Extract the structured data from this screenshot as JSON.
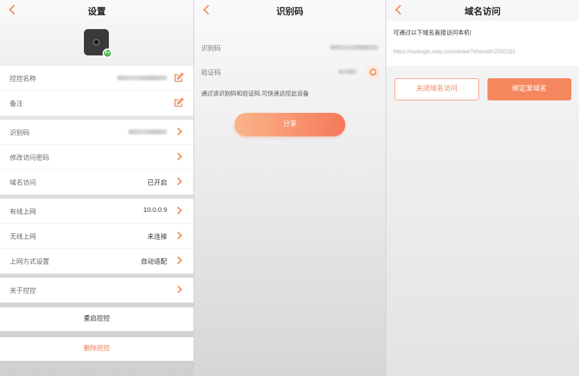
{
  "settings": {
    "title": "设置",
    "back_icon": "chevron-left-icon",
    "device_badge": "Fv",
    "group1": {
      "name_label": "控控名称",
      "remark_label": "备注"
    },
    "group2": {
      "id_label": "识别码",
      "change_password_label": "修改访问密码",
      "domain_label": "域名访问",
      "domain_value": "已开启"
    },
    "group3": {
      "wired_label": "有线上网",
      "wired_value": "10.0.0.9",
      "wireless_label": "无线上网",
      "wireless_value": "未连接",
      "network_mode_label": "上网方式设置",
      "network_mode_value": "自动适配"
    },
    "about_label": "关于控控",
    "restart_label": "重启控控",
    "delete_label": "删除控控"
  },
  "identify": {
    "title": "识别码",
    "id_label": "识别码",
    "verify_label": "验证码",
    "hint": "通过该识别码和验证码,可快速远控此设备",
    "share_label": "分享"
  },
  "domain": {
    "title": "域名访问",
    "description": "可通过以下域名直接访问本机!",
    "url": "https://sunlogin.oray.com/share?shareid=2581191",
    "close_label": "关闭域名访问",
    "bind_label": "绑定爱域名"
  },
  "colors": {
    "accent": "#f08a5d",
    "share_gradient_start": "#fbb58a",
    "share_gradient_end": "#f5795a",
    "delete_text": "#e87a55"
  }
}
